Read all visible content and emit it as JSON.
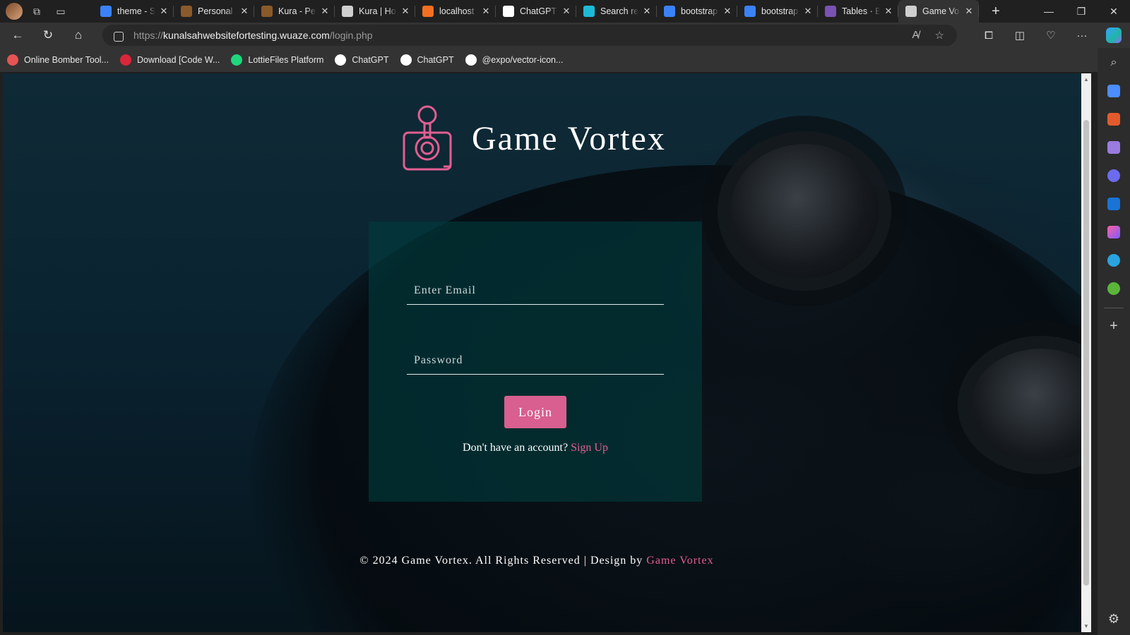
{
  "browser": {
    "tabs": [
      {
        "title": "theme - S",
        "favicon": "search-icon",
        "color": "#3b82f6"
      },
      {
        "title": "Personal",
        "favicon": "brown-page-icon",
        "color": "#8a5a2a"
      },
      {
        "title": "Kura - Pe",
        "favicon": "brown-page-icon",
        "color": "#8a5a2a"
      },
      {
        "title": "Kura | Ho",
        "favicon": "page-icon",
        "color": "#cfcfcf"
      },
      {
        "title": "localhost",
        "favicon": "xampp-icon",
        "color": "#f36f21"
      },
      {
        "title": "ChatGPT",
        "favicon": "chatgpt-icon",
        "color": "#ffffff"
      },
      {
        "title": "Search re",
        "favicon": "vuetify-icon",
        "color": "#1dbad8"
      },
      {
        "title": "bootstrap",
        "favicon": "search-icon",
        "color": "#3b82f6"
      },
      {
        "title": "bootstrap",
        "favicon": "search-icon",
        "color": "#3b82f6"
      },
      {
        "title": "Tables · B",
        "favicon": "bootstrap-icon",
        "color": "#7952b3"
      },
      {
        "title": "Game Vo",
        "favicon": "page-icon",
        "color": "#cfcfcf",
        "active": true
      }
    ],
    "address": {
      "prefix": "https://",
      "domain": "kunalsahwebsitefortesting.wuaze.com",
      "path": "/login.php"
    },
    "bookmarks": [
      {
        "label": "Online Bomber Tool...",
        "icon": "bomber-icon",
        "color": "#e55353"
      },
      {
        "label": "Download [Code W...",
        "icon": "1h-icon",
        "color": "#d9263a"
      },
      {
        "label": "LottieFiles Platform",
        "icon": "lottie-icon",
        "color": "#1fd67c"
      },
      {
        "label": "ChatGPT",
        "icon": "chatgpt-icon",
        "color": "#ffffff"
      },
      {
        "label": "ChatGPT",
        "icon": "chatgpt-icon",
        "color": "#ffffff"
      },
      {
        "label": "@expo/vector-icon...",
        "icon": "github-icon",
        "color": "#ffffff"
      }
    ]
  },
  "page": {
    "brand": "Game Vortex",
    "email_placeholder": "Enter Email",
    "password_placeholder": "Password",
    "login_label": "Login",
    "signup_prompt": "Don't have an account?",
    "signup_link": "Sign Up",
    "footer_text": "© 2024 Game Vortex. All Rights Reserved | Design by",
    "footer_link": "Game Vortex",
    "accent_color": "#d85f8f"
  }
}
